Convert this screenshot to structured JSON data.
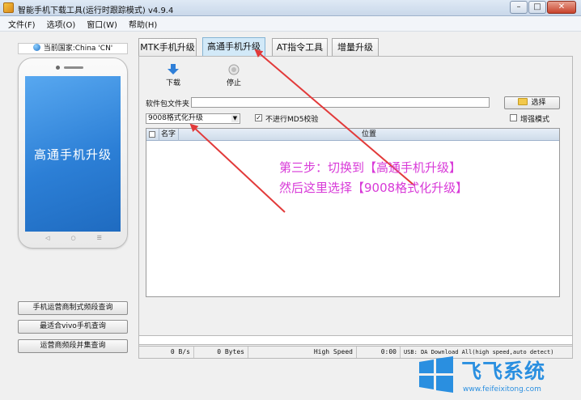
{
  "window": {
    "title": "智能手机下载工具(运行时跟踪模式)  v4.9.4",
    "controls": {
      "minimize": "–",
      "maximize": "□",
      "close": "✕"
    }
  },
  "menu": [
    "文件(F)",
    "选项(O)",
    "窗口(W)",
    "帮助(H)"
  ],
  "left": {
    "country": "当前国家:China 'CN'",
    "phone_screen_text": "高通手机升级",
    "phone_keys": [
      "◁",
      "○",
      "☰"
    ],
    "buttons": [
      "手机运营商制式频段查询",
      "最适合vivo手机查询",
      "运营商频段并集查询"
    ]
  },
  "tabs": [
    {
      "label": "MTK手机升级",
      "active": false
    },
    {
      "label": "高通手机升级",
      "active": true
    },
    {
      "label": "AT指令工具",
      "active": false
    },
    {
      "label": "增量升级",
      "active": false
    }
  ],
  "toolbar": {
    "download": "下载",
    "stop": "停止"
  },
  "form": {
    "folder_label": "软件包文件夹",
    "folder_value": "",
    "select_button": "选择",
    "mode_combo": "9008格式化升级",
    "no_md5_label": "不进行MD5校验",
    "no_md5_checked": true,
    "enhanced_label": "增强模式",
    "enhanced_checked": false
  },
  "grid": {
    "columns": [
      "名字",
      "位置"
    ]
  },
  "status": {
    "speed": "0 B/s",
    "bytes": "0 Bytes",
    "mode": "High Speed",
    "time": "0:00",
    "usb": "USB: DA Download All(high speed,auto detect)"
  },
  "annotation": {
    "line1": "第三步：切换到【高通手机升级】",
    "line2": "然后这里选择【9008格式化升级】",
    "color": "#d83ad8"
  },
  "watermark": {
    "brand": "飞飞系统",
    "url": "www.feifeixitong.com"
  },
  "colors": {
    "active_tab": "#d2e9f8",
    "phone_screen": "#2c7fd6",
    "arrow": "#e23a3a"
  }
}
